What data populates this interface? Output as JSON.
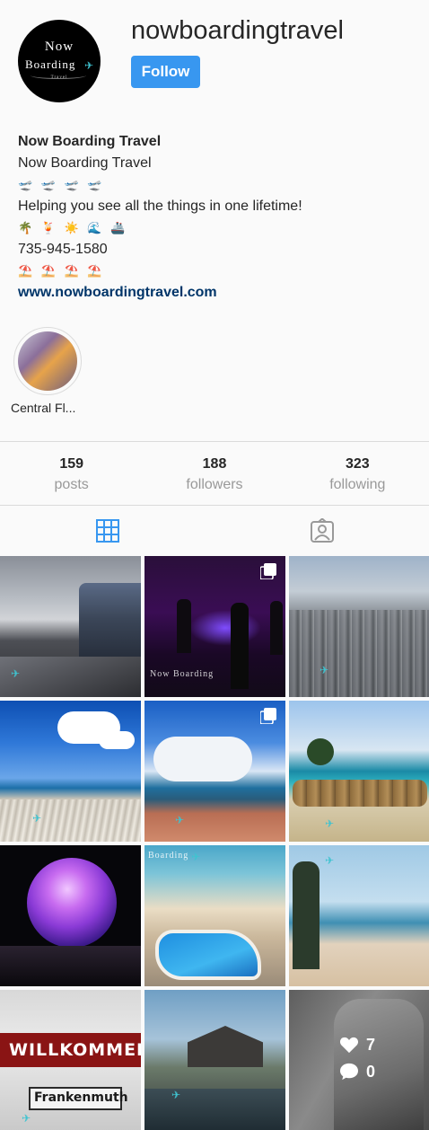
{
  "profile": {
    "username": "nowboardingtravel",
    "follow_label": "Follow",
    "avatar": {
      "line1": "Now",
      "line2": "Boarding",
      "line3": "Travel"
    }
  },
  "bio": {
    "name": "Now Boarding Travel",
    "category": "Now Boarding Travel",
    "emoji_line1": "🛫 🛫 🛫 🛫",
    "tagline": "Helping you see all the things in one lifetime!",
    "emoji_line2": "🌴 🍹 ☀️ 🌊 🚢",
    "phone": "735-945-1580",
    "emoji_line3": "⛱️ ⛱️ ⛱️ ⛱️",
    "website": "www.nowboardingtravel.com"
  },
  "highlights": [
    {
      "label": "Central Fl..."
    }
  ],
  "stats": {
    "posts": {
      "value": "159",
      "label": "posts"
    },
    "followers": {
      "value": "188",
      "label": "followers"
    },
    "following": {
      "value": "323",
      "label": "following"
    }
  },
  "tabs": [
    {
      "name": "grid",
      "active": true
    },
    {
      "name": "tagged",
      "active": false
    }
  ],
  "colors": {
    "accent": "#3897f0",
    "link": "#003569",
    "tab_active": "#3897f0",
    "tab_inactive": "#999999"
  },
  "posts": [
    {
      "subject": "train station",
      "multi": false
    },
    {
      "subject": "violin concert",
      "multi": true,
      "watermark": "Now Boarding"
    },
    {
      "subject": "city skyline",
      "multi": false
    },
    {
      "subject": "beach chairs",
      "multi": false
    },
    {
      "subject": "ocean clouds",
      "multi": true
    },
    {
      "subject": "tiki umbrellas beach",
      "multi": false
    },
    {
      "subject": "spaceship earth",
      "multi": false
    },
    {
      "subject": "resort pool",
      "multi": false,
      "watermark": "Boarding"
    },
    {
      "subject": "sand dunes",
      "multi": false
    },
    {
      "subject": "Frankenmuth sign",
      "multi": false,
      "sign_top": "WILLKOMMEN",
      "sign_bottom": "Frankenmuth"
    },
    {
      "subject": "japanese castle",
      "multi": false
    },
    {
      "subject": "memorial statue",
      "multi": false,
      "likes": "7",
      "comments": "0"
    }
  ]
}
